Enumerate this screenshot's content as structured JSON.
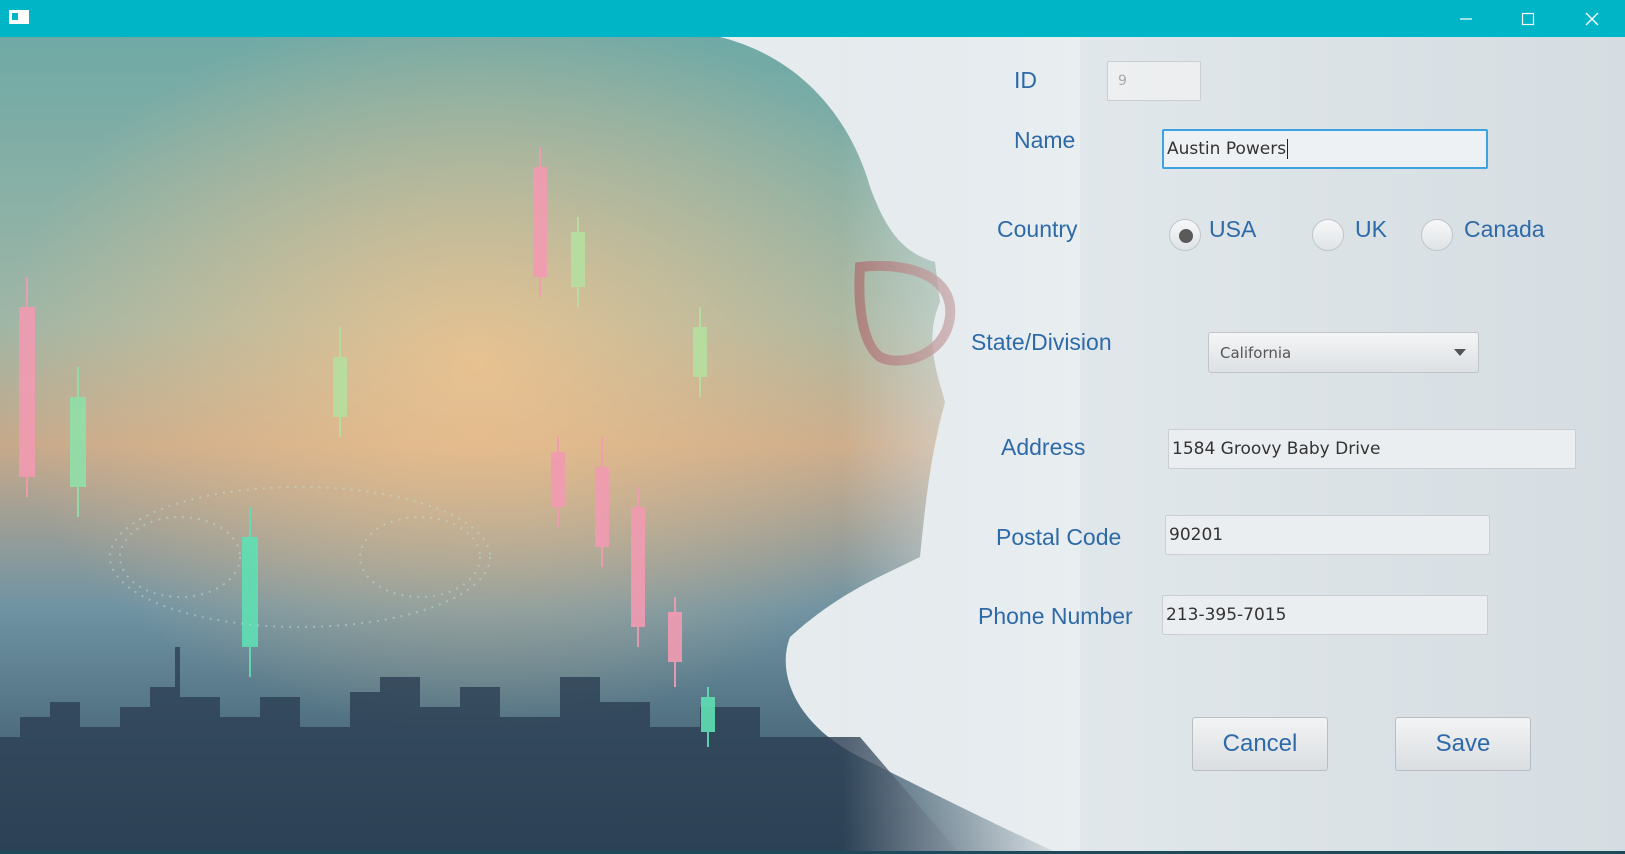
{
  "window": {
    "icons": {
      "app": "app-icon",
      "minimize": "minimize-icon",
      "maximize": "maximize-icon",
      "close": "close-icon"
    },
    "title_bar_color": "#00b5c6"
  },
  "form": {
    "id": {
      "label": "ID",
      "value": "9"
    },
    "name": {
      "label": "Name",
      "value": "Austin Powers"
    },
    "country": {
      "label": "Country",
      "options": [
        {
          "label": "USA",
          "checked": true
        },
        {
          "label": "UK",
          "checked": false
        },
        {
          "label": "Canada",
          "checked": false
        }
      ]
    },
    "state": {
      "label": "State/Division",
      "value": "California"
    },
    "address": {
      "label": "Address",
      "value": "1584 Groovy Baby Drive"
    },
    "postal": {
      "label": "Postal Code",
      "value": "90201"
    },
    "phone": {
      "label": "Phone Number",
      "value": "213-395-7015"
    },
    "buttons": {
      "cancel": "Cancel",
      "save": "Save"
    }
  },
  "colors": {
    "accent": "#2e6aa8",
    "focus": "#3da3e0"
  }
}
